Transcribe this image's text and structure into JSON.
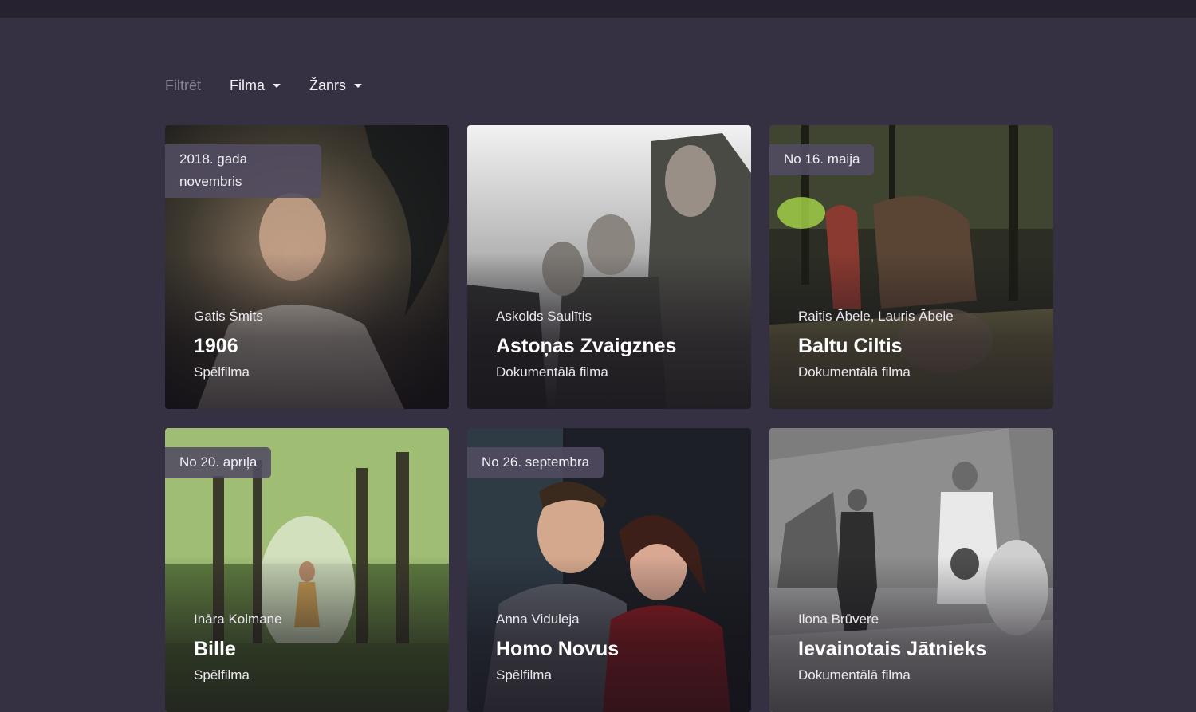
{
  "filters": {
    "label": "Filtrēt",
    "film_dropdown": "Filma",
    "genre_dropdown": "Žanrs"
  },
  "films": [
    {
      "badge": "2018. gada novembris",
      "director": "Gatis Šmits",
      "title": "1906",
      "type": "Spēlfilma"
    },
    {
      "badge": "",
      "director": "Askolds Saulītis",
      "title": "Astoņas Zvaigznes",
      "type": "Dokumentālā filma"
    },
    {
      "badge": "No 16. maija",
      "director": "Raitis Ābele, Lauris Ābele",
      "title": "Baltu Ciltis",
      "type": "Dokumentālā filma"
    },
    {
      "badge": "No 20. aprīļa",
      "director": "Ināra Kolmane",
      "title": "Bille",
      "type": "Spēlfilma"
    },
    {
      "badge": "No 26. septembra",
      "director": "Anna Viduleja",
      "title": "Homo Novus",
      "type": "Spēlfilma"
    },
    {
      "badge": "",
      "director": "Ilona Brūvere",
      "title": "Ievainotais Jātnieks",
      "type": "Dokumentālā filma"
    }
  ],
  "colors": {
    "background": "#363142",
    "topbar": "#26222f",
    "badge": "#524c62",
    "muted_text": "#8a8595"
  }
}
